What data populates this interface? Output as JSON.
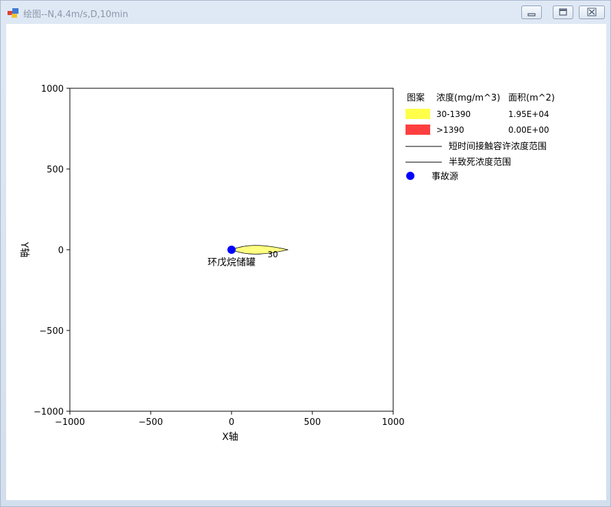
{
  "window": {
    "title": "绘图--N,4.4m/s,D,10min"
  },
  "legend": {
    "header_pattern": "图案",
    "header_conc": "浓度(mg/m^3)",
    "header_area": "面积(m^2)",
    "rows": [
      {
        "range": "30-1390",
        "area": "1.95E+04",
        "color": "#ffff4a"
      },
      {
        "range": ">1390",
        "area": "0.00E+00",
        "color": "#ff3f3f"
      }
    ],
    "line1_label": "短时间接触容许浓度范围",
    "line2_label": "半致死浓度范围",
    "source_label": "事故源"
  },
  "chart_data": {
    "type": "scatter",
    "xlabel": "X轴",
    "ylabel": "Y轴",
    "xlim": [
      -1000,
      1000
    ],
    "ylim": [
      -1000,
      1000
    ],
    "xticks": [
      -1000,
      -500,
      0,
      500,
      1000
    ],
    "yticks": [
      -1000,
      -500,
      0,
      500,
      1000
    ],
    "xtick_labels": [
      "−1000",
      "−500",
      "0",
      "500",
      "1000"
    ],
    "ytick_labels": [
      "−1000",
      "−500",
      "0",
      "500",
      "1000"
    ],
    "grid": false,
    "source_point": {
      "x": 0,
      "y": 0,
      "color": "#0000ff"
    },
    "source_name": "环戊烷储罐",
    "plume": {
      "contour_value": "30",
      "x_start": 0,
      "x_end": 350,
      "half_width": 18,
      "color": "#ffff80"
    }
  }
}
